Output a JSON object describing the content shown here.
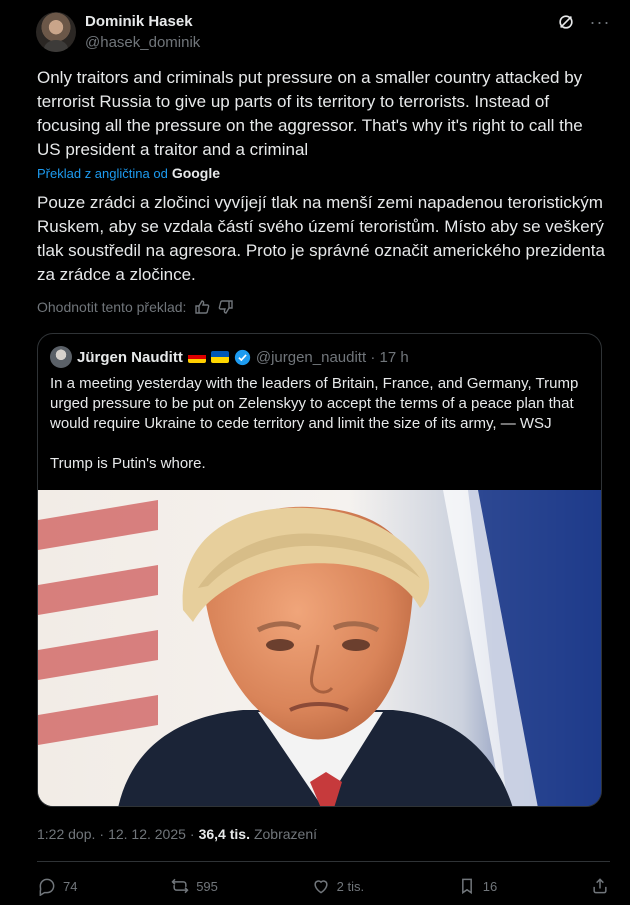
{
  "post": {
    "author_name": "Dominik Hasek",
    "author_handle": "@hasek_dominik",
    "original_text": "Only traitors and criminals put pressure on a smaller country attacked by terrorist Russia to give up parts of its territory to terrorists. Instead of focusing all the pressure on the aggressor. That's why it's right to call the US president a traitor and a criminal",
    "translated_by": "Překlad z angličtina od",
    "translated_by_brand": "Google",
    "translated_text": "Pouze zrádci a zločinci vyvíjejí tlak na menší zemi napadenou teroristickým Ruskem, aby se vzdala částí svého území teroristům. Místo aby se veškerý tlak soustředil na agresora. Proto je správné označit amerického prezidenta za zrádce a zločince.",
    "rate_translation": "Ohodnotit tento překlad:"
  },
  "quote": {
    "author_name": "Jürgen Nauditt",
    "handle_time": "@jurgen_nauditt · 17 h",
    "body": "In a meeting yesterday with the leaders of Britain, France, and Germany, Trump urged pressure to be put on Zelenskyy to accept the terms of a peace plan that would require Ukraine to cede territory and limit the size of its army, — WSJ\n\nTrump is Putin's whore."
  },
  "meta": {
    "time": "1:22 dop.",
    "separator": "·",
    "date": "12. 12. 2025",
    "separator2": "·",
    "views_count": "36,4 tis.",
    "views_label": "Zobrazení"
  },
  "actions": {
    "replies": "74",
    "reposts": "595",
    "likes": "2 tis.",
    "bookmarks": "16"
  },
  "colors": {
    "background": "#000000",
    "text": "#e7e9ea",
    "secondary": "#71767b",
    "accent": "#1d9bf0",
    "border": "#2f3336"
  },
  "icons": [
    "grok-icon",
    "more-icon",
    "thumbs-up-icon",
    "thumbs-down-icon",
    "verified-badge-icon",
    "reply-icon",
    "repost-icon",
    "like-icon",
    "bookmark-icon",
    "share-icon"
  ]
}
